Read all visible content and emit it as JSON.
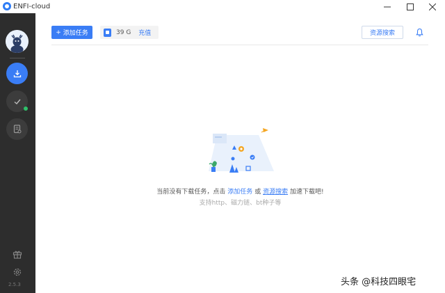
{
  "window": {
    "title": "ENFI-cloud",
    "controls": [
      "minimize-icon",
      "maximize-icon",
      "close-icon"
    ]
  },
  "sidebar": {
    "items": [
      {
        "name": "download",
        "icon": "download-icon",
        "active": true
      },
      {
        "name": "completed",
        "icon": "check-icon",
        "badge_color": "#2ec16a"
      },
      {
        "name": "files",
        "icon": "document-icon"
      }
    ],
    "bottom": [
      {
        "icon": "gift-icon"
      },
      {
        "icon": "gear-icon"
      }
    ],
    "version": "2.5.3"
  },
  "toolbar": {
    "add_task_label": "添加任务",
    "add_task_plus": "+",
    "storage_size": "39 G",
    "recharge_label": "充值",
    "resource_search_label": "资源搜索"
  },
  "empty_state": {
    "line1_prefix": "当前没有下载任务，点击",
    "link_add_task": "添加任务",
    "line1_or": "或",
    "link_resource_search": "资源搜索",
    "line1_suffix": "加速下载吧!",
    "line2": "支持http、磁力链、bt种子等"
  },
  "watermark": "头条 @科技四眼宅",
  "colors": {
    "accent": "#3a7df5",
    "sidebar_bg": "#2d2d2d",
    "online_dot": "#2ec16a"
  }
}
